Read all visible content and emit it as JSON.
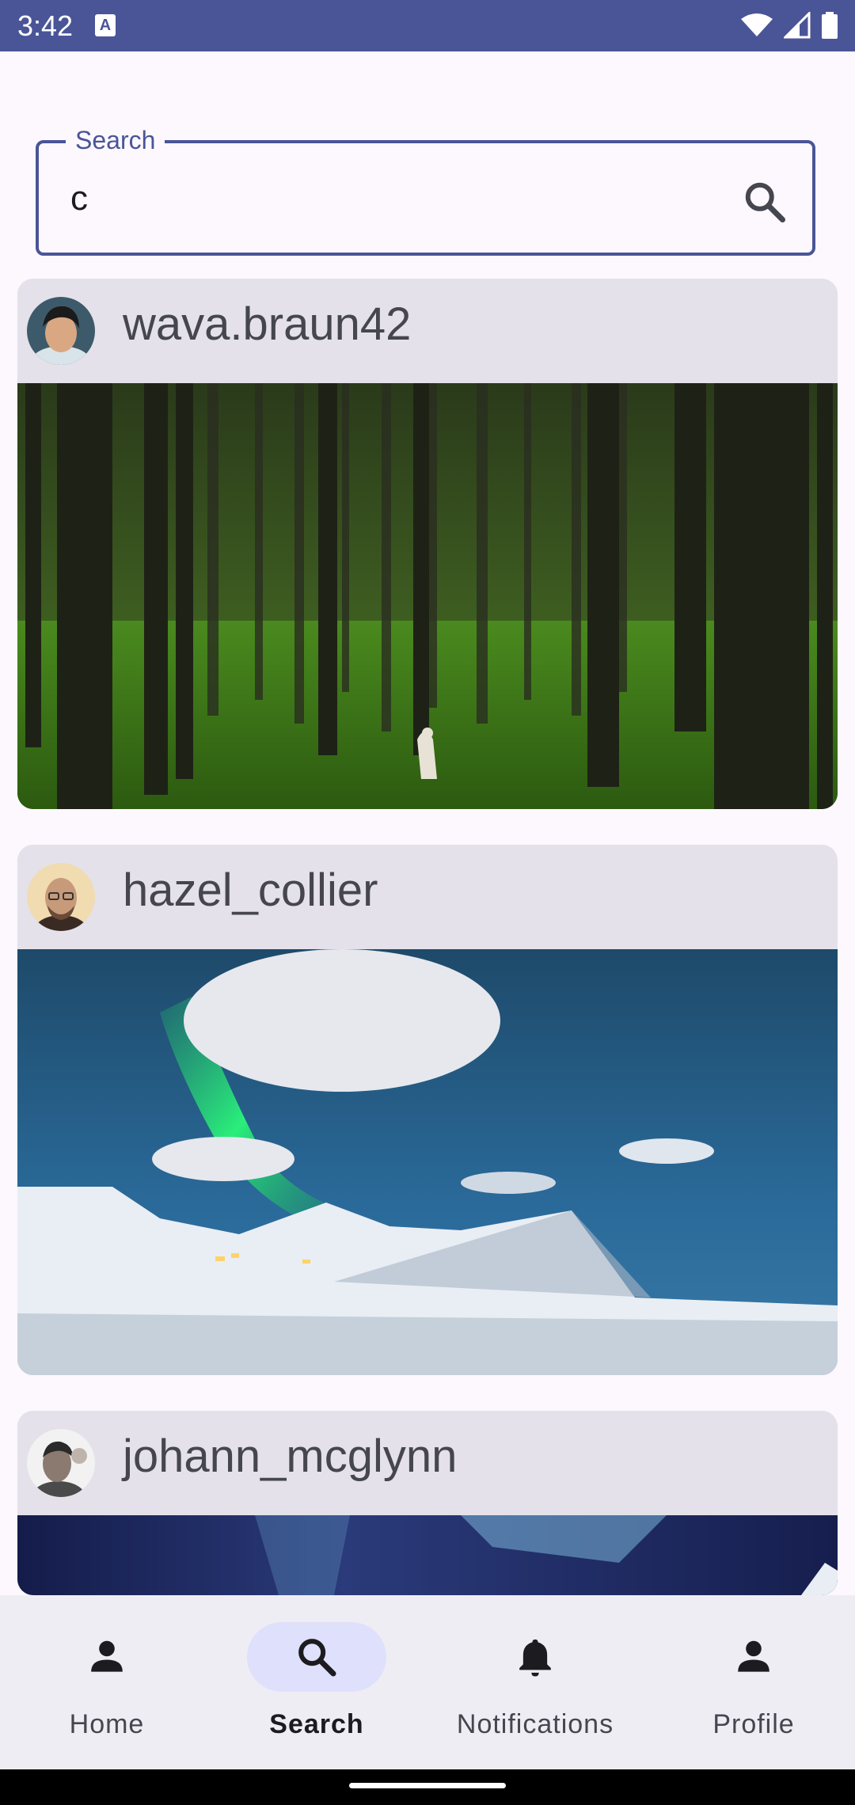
{
  "status_bar": {
    "time": "3:42",
    "notification_icon": "a-icon"
  },
  "search": {
    "label": "Search",
    "value": "c",
    "button_icon": "search-icon"
  },
  "posts": [
    {
      "username": "wava.braun42",
      "image": "forest with a hiker among tall trees"
    },
    {
      "username": "hazel_collier",
      "image": "aurora over snowy mountains"
    },
    {
      "username": "johann_mcglynn",
      "image": "aurora night sky"
    }
  ],
  "nav": {
    "items": [
      {
        "label": "Home",
        "icon": "person-icon",
        "active": false
      },
      {
        "label": "Search",
        "icon": "search-icon",
        "active": true
      },
      {
        "label": "Notifications",
        "icon": "bell-icon",
        "active": false
      },
      {
        "label": "Profile",
        "icon": "person-icon",
        "active": false
      }
    ]
  },
  "colors": {
    "accent": "#4a5598",
    "surface": "#fdf8fd",
    "card": "#e4e1ea",
    "nav": "#efedf4",
    "pill": "#dfe0fb"
  }
}
